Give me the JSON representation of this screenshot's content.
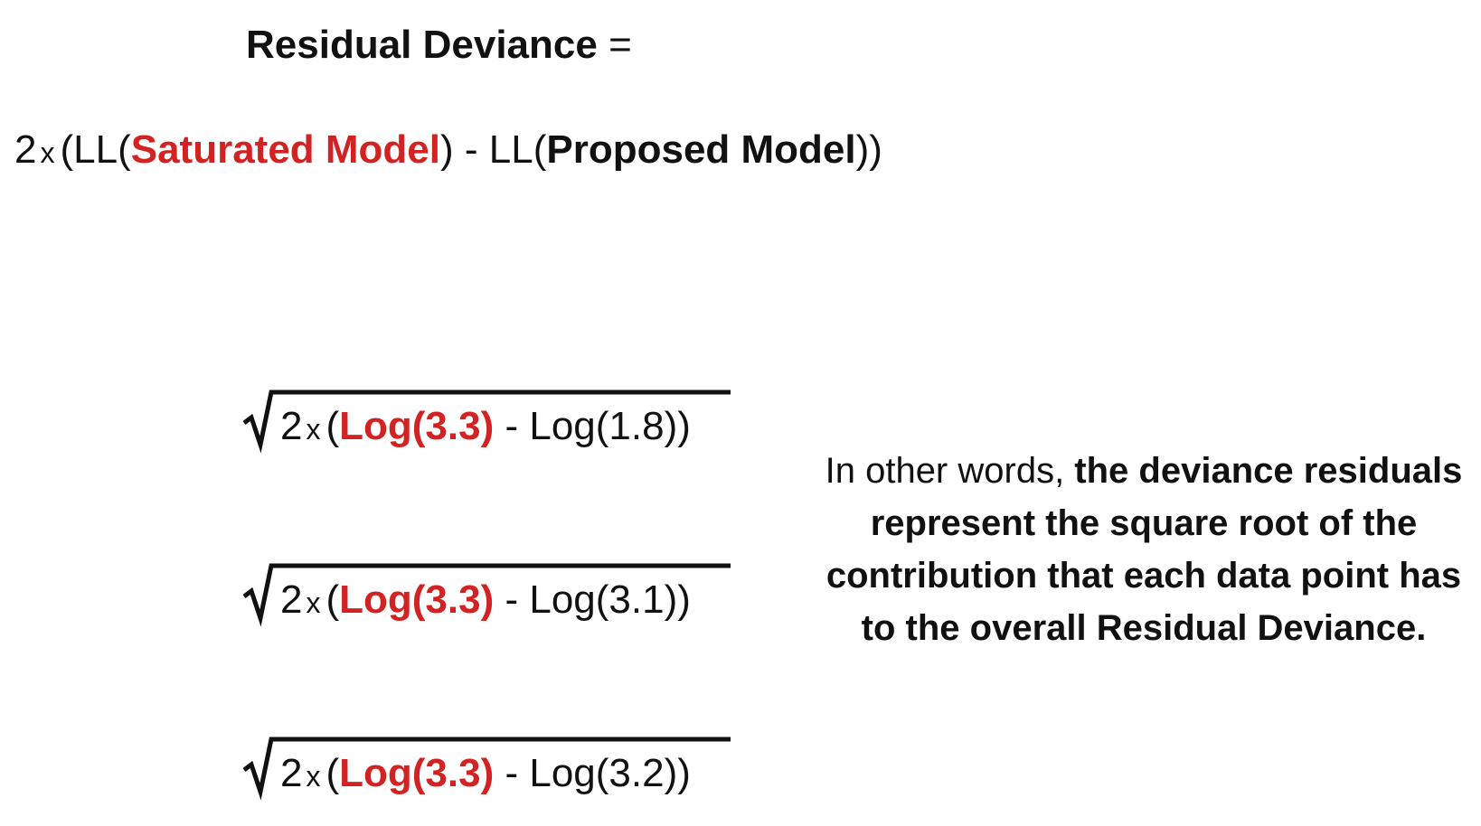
{
  "title": {
    "label": "Residual Deviance",
    "equals": "="
  },
  "formula": {
    "coefficient": "2",
    "times": "x",
    "open_ll_1": "(LL(",
    "saturated": "Saturated Model",
    "mid": ") - LL(",
    "proposed": "Proposed Model",
    "close": "))"
  },
  "sqrt_rows": [
    {
      "coefficient": "2",
      "times": "x",
      "open": "(",
      "saturated_log": "Log(3.3)",
      "minus": " - ",
      "proposed_log": "Log(1.8)",
      "close": ")"
    },
    {
      "coefficient": "2",
      "times": "x",
      "open": "(",
      "saturated_log": "Log(3.3)",
      "minus": " - ",
      "proposed_log": "Log(3.1)",
      "close": ")"
    },
    {
      "coefficient": "2",
      "times": "x",
      "open": "(",
      "saturated_log": "Log(3.3)",
      "minus": " - ",
      "proposed_log": "Log(3.2)",
      "close": ")"
    }
  ],
  "explanation": {
    "intro": "In other words, ",
    "emphasis": "the deviance residuals represent the square root of the contribution that each data point has to the overall Residual Deviance."
  },
  "colors": {
    "accent_red": "#d32222",
    "text": "#111111"
  }
}
